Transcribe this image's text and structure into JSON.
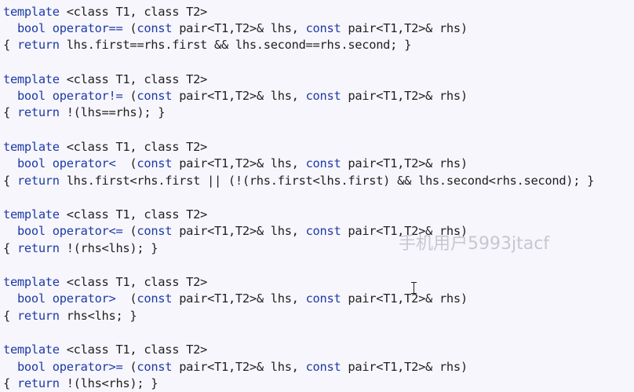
{
  "code": {
    "blocks": [
      {
        "template_kw": "template",
        "template_params": " <class T1, class T2>",
        "bool_kw": "bool",
        "operator_kw": "operator==",
        "sig_open": " (",
        "const1": "const",
        "param1": " pair<T1,T2>& lhs, ",
        "const2": "const",
        "param2": " pair<T1,T2>& rhs)",
        "body_open": "{ ",
        "return_kw": "return",
        "body_expr": " lhs.first==rhs.first && lhs.second==rhs.second; }"
      },
      {
        "template_kw": "template",
        "template_params": " <class T1, class T2>",
        "bool_kw": "bool",
        "operator_kw": "operator!=",
        "sig_open": " (",
        "const1": "const",
        "param1": " pair<T1,T2>& lhs, ",
        "const2": "const",
        "param2": " pair<T1,T2>& rhs)",
        "body_open": "{ ",
        "return_kw": "return",
        "body_expr": " !(lhs==rhs); }"
      },
      {
        "template_kw": "template",
        "template_params": " <class T1, class T2>",
        "bool_kw": "bool",
        "operator_kw": "operator<",
        "sig_open": "  (",
        "const1": "const",
        "param1": " pair<T1,T2>& lhs, ",
        "const2": "const",
        "param2": " pair<T1,T2>& rhs)",
        "body_open": "{ ",
        "return_kw": "return",
        "body_expr": " lhs.first<rhs.first || (!(rhs.first<lhs.first) && lhs.second<rhs.second); }"
      },
      {
        "template_kw": "template",
        "template_params": " <class T1, class T2>",
        "bool_kw": "bool",
        "operator_kw": "operator<=",
        "sig_open": " (",
        "const1": "const",
        "param1": " pair<T1,T2>& lhs, ",
        "const2": "const",
        "param2": " pair<T1,T2>& rhs)",
        "body_open": "{ ",
        "return_kw": "return",
        "body_expr": " !(rhs<lhs); }"
      },
      {
        "template_kw": "template",
        "template_params": " <class T1, class T2>",
        "bool_kw": "bool",
        "operator_kw": "operator>",
        "sig_open": "  (",
        "const1": "const",
        "param1": " pair<T1,T2>& lhs, ",
        "const2": "const",
        "param2": " pair<T1,T2>& rhs)",
        "body_open": "{ ",
        "return_kw": "return",
        "body_expr": " rhs<lhs; }"
      },
      {
        "template_kw": "template",
        "template_params": " <class T1, class T2>",
        "bool_kw": "bool",
        "operator_kw": "operator>=",
        "sig_open": " (",
        "const1": "const",
        "param1": " pair<T1,T2>& lhs, ",
        "const2": "const",
        "param2": " pair<T1,T2>& rhs)",
        "body_open": "{ ",
        "return_kw": "return",
        "body_expr": " !(lhs<rhs); }"
      }
    ]
  },
  "watermark": {
    "text": "手机用户5993jtacf"
  },
  "colors": {
    "background": "#f7f6fc",
    "keyword": "#1c3aa6",
    "text": "#1f1f1f"
  },
  "cursor": {
    "icon": "text-cursor-icon"
  }
}
